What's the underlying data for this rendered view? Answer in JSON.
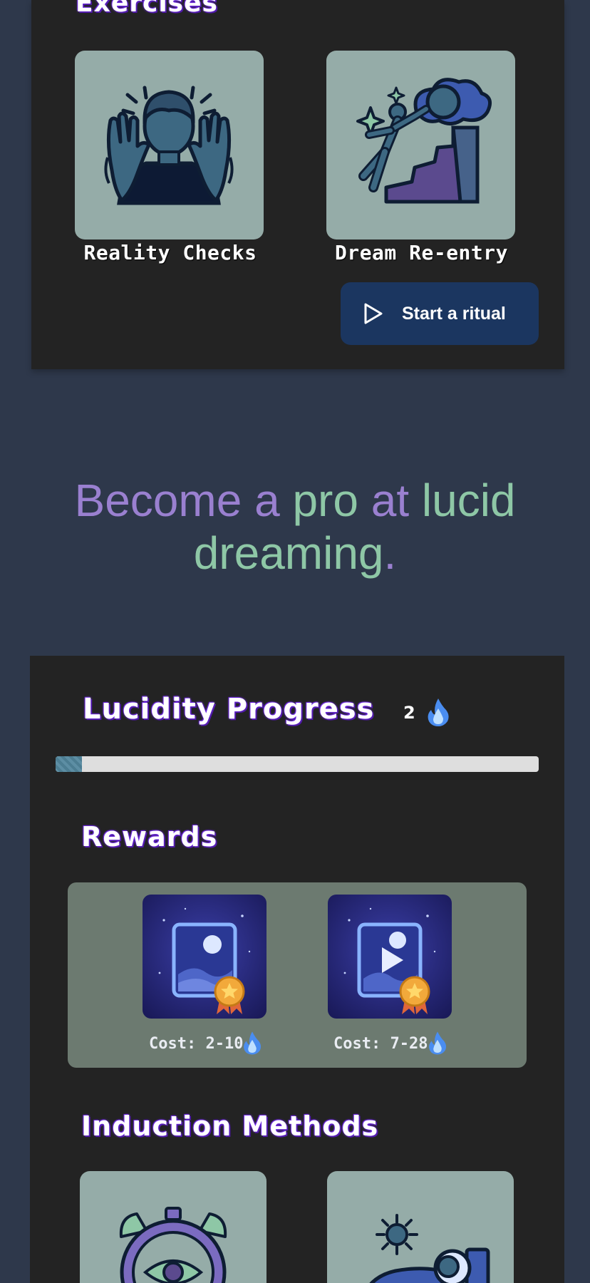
{
  "exercises": {
    "heading": "Exercises",
    "tiles": [
      {
        "label": "Reality Checks",
        "icon": "hands-raised-person-icon"
      },
      {
        "label": "Dream Re-entry",
        "icon": "dream-climb-icon"
      }
    ],
    "start_button": {
      "label": "Start a ritual",
      "icon": "play-icon"
    }
  },
  "tagline": {
    "parts": [
      {
        "text": "Become a ",
        "color": "#9a80d0"
      },
      {
        "text": "pro ",
        "color": "#8ec7a6"
      },
      {
        "text": "at ",
        "color": "#9a80d0"
      },
      {
        "text": "lucid dreaming",
        "color": "#8ec7a6"
      },
      {
        "text": ".",
        "color": "#9a80d0"
      }
    ]
  },
  "progress": {
    "heading": "Lucidity Progress",
    "flame_count": "2",
    "flame_icon": "blue-flame-icon",
    "fill_fraction": 0.055,
    "accent": "#5d8ea4"
  },
  "rewards": {
    "heading": "Rewards",
    "items": [
      {
        "cost": "Cost: 2-10",
        "icon": "moon-picture-badge-icon"
      },
      {
        "cost": "Cost: 7-28",
        "icon": "moon-video-badge-icon"
      }
    ]
  },
  "induction": {
    "heading": "Induction Methods",
    "tiles": [
      {
        "icon": "alarm-clock-eye-icon"
      },
      {
        "icon": "sleeping-person-sun-icon"
      }
    ]
  }
}
